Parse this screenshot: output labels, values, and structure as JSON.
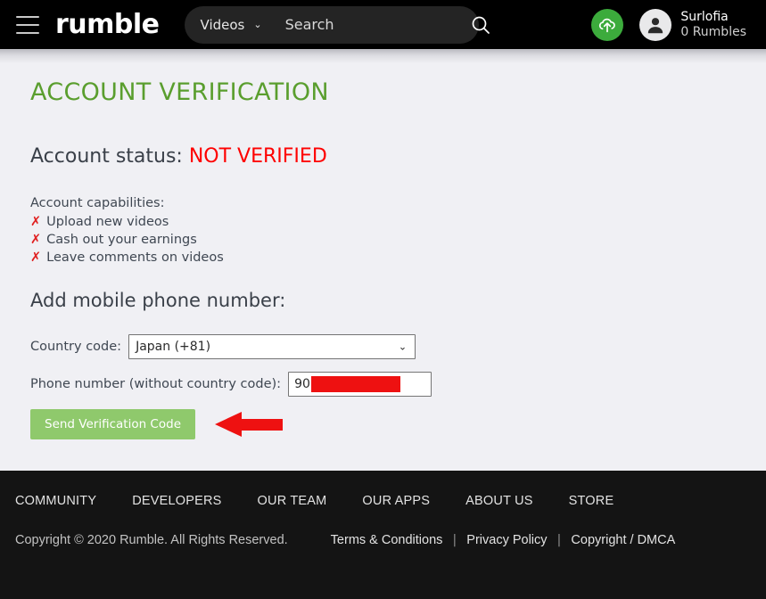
{
  "header": {
    "menu_icon": "hamburger-icon",
    "logo_text": "rumble",
    "search": {
      "category": "Videos",
      "caret": "⌄",
      "placeholder": "Search",
      "value": "",
      "icon": "search-icon"
    },
    "upload_icon": "cloud-upload-icon",
    "avatar_icon": "user-avatar-icon",
    "user_name": "Surlofia",
    "user_rumbles": "0 Rumbles"
  },
  "main": {
    "page_title": "ACCOUNT VERIFICATION",
    "status_label": "Account status:",
    "status_value": "NOT VERIFIED",
    "capabilities_title": "Account capabilities:",
    "capabilities": [
      {
        "mark": "✗",
        "label": "Upload new videos"
      },
      {
        "mark": "✗",
        "label": "Cash out your earnings"
      },
      {
        "mark": "✗",
        "label": "Leave comments on videos"
      }
    ],
    "section_title": "Add mobile phone number:",
    "country_label": "Country code:",
    "country_value": "Japan (+81)",
    "country_caret": "⌄",
    "phone_label": "Phone number (without country code):",
    "phone_value": "90",
    "phone_redacted": true,
    "send_button": "Send Verification Code",
    "annotation_arrow": "red-left-arrow"
  },
  "footer": {
    "nav": [
      {
        "label": "COMMUNITY"
      },
      {
        "label": "DEVELOPERS"
      },
      {
        "label": "OUR TEAM"
      },
      {
        "label": "OUR APPS"
      },
      {
        "label": "ABOUT US"
      },
      {
        "label": "STORE"
      }
    ],
    "copyright": "Copyright © 2020 Rumble. All Rights Reserved.",
    "legal": [
      {
        "label": "Terms & Conditions"
      },
      {
        "label": "Privacy Policy"
      },
      {
        "label": "Copyright / DMCA"
      }
    ],
    "separator": "|"
  },
  "colors": {
    "header_bg": "#000000",
    "page_bg": "#f0f0f4",
    "footer_bg": "#141414",
    "title_green": "#5a9e2e",
    "status_red": "#fe0000",
    "button_green": "#8fc96c",
    "upload_green": "#3cab3c",
    "arrow_red": "#ee1111"
  }
}
